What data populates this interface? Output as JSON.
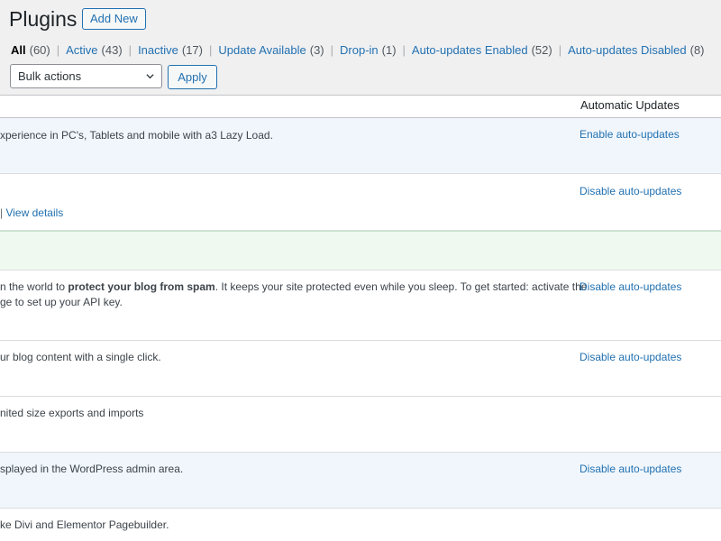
{
  "header": {
    "title": "Plugins",
    "add_new_label": "Add New"
  },
  "filters": [
    {
      "label": "All",
      "count": "(60)",
      "current": true
    },
    {
      "label": "Active",
      "count": "(43)",
      "current": false
    },
    {
      "label": "Inactive",
      "count": "(17)",
      "current": false
    },
    {
      "label": "Update Available",
      "count": "(3)",
      "current": false
    },
    {
      "label": "Drop-in",
      "count": "(1)",
      "current": false
    },
    {
      "label": "Auto-updates Enabled",
      "count": "(52)",
      "current": false
    },
    {
      "label": "Auto-updates Disabled",
      "count": "(8)",
      "current": false
    }
  ],
  "bulk": {
    "selected": "Bulk actions",
    "apply_label": "Apply"
  },
  "table": {
    "col_automatic_updates": "Automatic Updates",
    "rows": [
      {
        "desc_pre": "xperience in PC's, Tablets and mobile with a3 Lazy Load.",
        "desc_bold": "",
        "desc_post": "",
        "desc2": "",
        "auto": "Enable auto-updates",
        "active": true
      },
      {
        "desc_pre": "",
        "desc_bold": "",
        "desc_post": "",
        "desc2": "",
        "links_bar": "|",
        "links_view": "View details",
        "auto": "Disable auto-updates",
        "active": false
      },
      {
        "update_row": true
      },
      {
        "desc_pre": "n the world to ",
        "desc_bold": "protect your blog from spam",
        "desc_post": ". It keeps your site protected even while you sleep. To get started: activate the",
        "desc2": "ge to set up your API key.",
        "auto": "Disable auto-updates",
        "active": false
      },
      {
        "desc_pre": "ur blog content with a single click.",
        "desc_bold": "",
        "desc_post": "",
        "desc2": "",
        "auto": "Disable auto-updates",
        "active": false
      },
      {
        "desc_pre": "nited size exports and imports",
        "desc_bold": "",
        "desc_post": "",
        "desc2": "",
        "auto": "",
        "active": false
      },
      {
        "desc_pre": "splayed in the WordPress admin area.",
        "desc_bold": "",
        "desc_post": "",
        "desc2": "",
        "auto": "Disable auto-updates",
        "active": true
      },
      {
        "desc_pre": "ke Divi and Elementor Pagebuilder.",
        "desc_bold": "",
        "desc_post": "",
        "desc2": "",
        "auto": "",
        "active": false
      }
    ]
  },
  "colors": {
    "link": "#2271b1",
    "active_row": "#f0f6fc",
    "update_row": "#f0f9f0",
    "bg": "#f0f0f1"
  }
}
